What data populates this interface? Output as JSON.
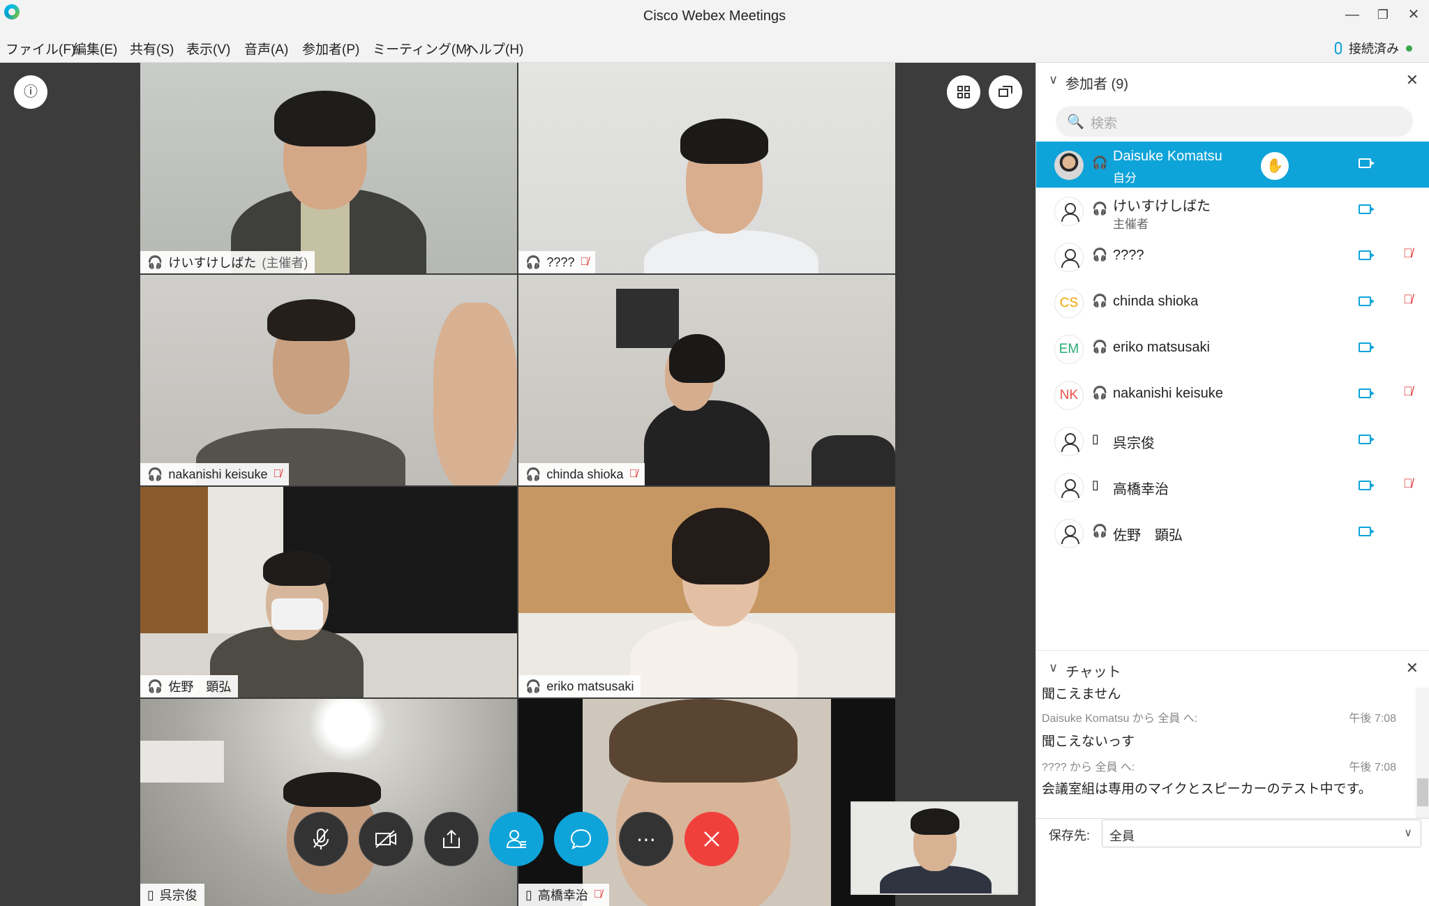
{
  "window": {
    "title": "Cisco Webex Meetings",
    "minimize": "—",
    "restore": "❐",
    "close": "✕"
  },
  "menu": [
    "ファイル(F)",
    "編集(E)",
    "共有(S)",
    "表示(V)",
    "音声(A)",
    "参加者(P)",
    "ミーティング(M)",
    "ヘルプ(H)"
  ],
  "status": {
    "label": "接続済み",
    "color": "#3aa64c"
  },
  "tiles": [
    {
      "name": "けいすけしばた",
      "role": "(主催者)",
      "muted": false
    },
    {
      "name": "????",
      "role": "",
      "muted": true
    },
    {
      "name": "nakanishi keisuke",
      "role": "",
      "muted": true
    },
    {
      "name": "chinda shioka",
      "role": "",
      "muted": true
    },
    {
      "name": "佐野　顕弘",
      "role": "",
      "muted": false
    },
    {
      "name": "eriko matsusaki",
      "role": "",
      "muted": false
    },
    {
      "name": "呉宗俊",
      "role": "",
      "muted": false
    },
    {
      "name": "高橋幸治",
      "role": "",
      "muted": true
    }
  ],
  "controls": [
    "mute",
    "video",
    "share",
    "participants",
    "chat",
    "more",
    "leave"
  ],
  "participants_panel": {
    "title": "参加者 (9)",
    "search_placeholder": "検索",
    "items": [
      {
        "name": "Daisuke Komatsu",
        "role": "自分",
        "avatar": "photo",
        "audio": "headset",
        "muted": false,
        "active": true,
        "hand": true
      },
      {
        "name": "けいすけしばた",
        "role": "主催者",
        "avatar": "person",
        "audio": "headset",
        "muted": false
      },
      {
        "name": "????",
        "role": "",
        "avatar": "person",
        "audio": "headset",
        "muted": true
      },
      {
        "name": "chinda shioka",
        "role": "",
        "avatar": "CS",
        "avatar_color": "#f0a500",
        "audio": "headset",
        "muted": true
      },
      {
        "name": "eriko matsusaki",
        "role": "",
        "avatar": "EM",
        "avatar_color": "#2aa876",
        "audio": "headset",
        "muted": false
      },
      {
        "name": "nakanishi keisuke",
        "role": "",
        "avatar": "NK",
        "avatar_color": "#e8534a",
        "audio": "headset",
        "muted": true
      },
      {
        "name": "呉宗俊",
        "role": "",
        "avatar": "person",
        "audio": "phone",
        "muted": false
      },
      {
        "name": "高橋幸治",
        "role": "",
        "avatar": "person",
        "audio": "phone",
        "muted": true
      },
      {
        "name": "佐野　顕弘",
        "role": "",
        "avatar": "person",
        "audio": "headset",
        "muted": false
      }
    ]
  },
  "chat": {
    "title": "チャット",
    "partial_line": "聞こえません",
    "messages": [
      {
        "from": "Daisuke Komatsu から 全員 へ:",
        "time": "午後 7:08",
        "text": "聞こえないっす"
      },
      {
        "from": "???? から 全員 へ:",
        "time": "午後 7:08",
        "text": "会議室組は専用のマイクとスピーカーのテスト中です。"
      }
    ],
    "save_label": "保存先:",
    "save_value": "全員"
  },
  "colors": {
    "accent": "#0ea3d9",
    "danger": "#f0403c",
    "stage": "#3c3c3c"
  }
}
